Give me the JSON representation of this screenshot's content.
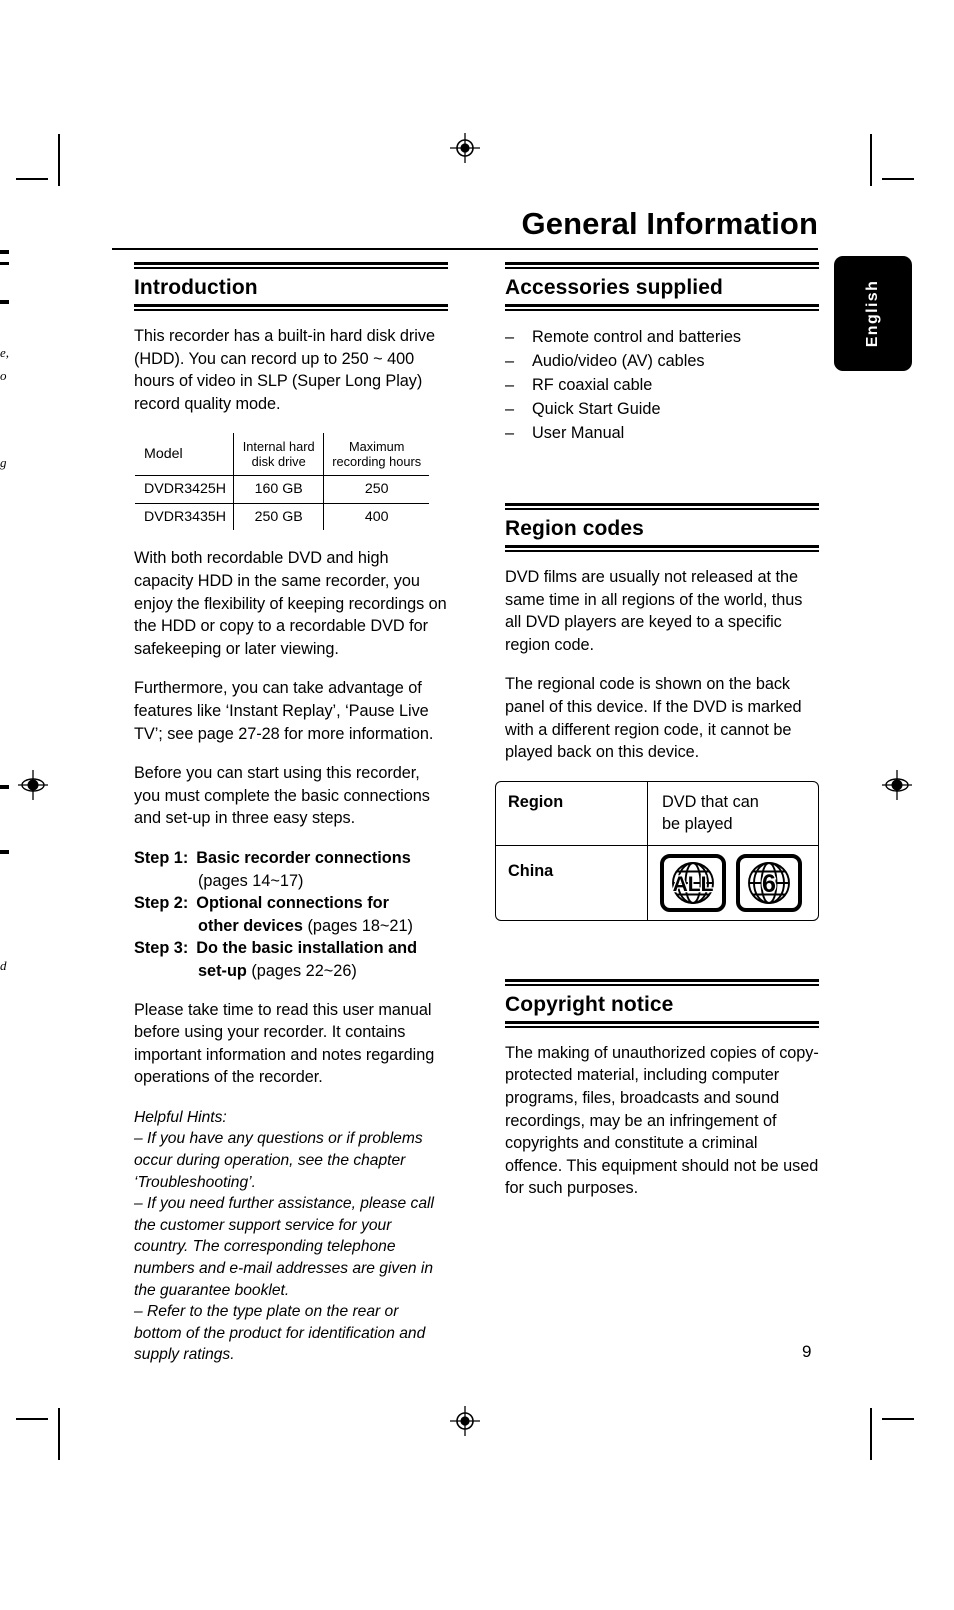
{
  "page": {
    "running_head": "General Information",
    "language_tab": "English",
    "page_number": "9"
  },
  "left_column": {
    "introduction": {
      "heading": "Introduction",
      "paragraph_1": "This recorder has a built-in hard disk drive (HDD). You can record up to 250 ~ 400 hours of video in SLP (Super Long Play) record quality mode.",
      "model_table": {
        "headers": [
          "Model",
          "Internal hard disk drive",
          "Maximum recording hours"
        ],
        "header_line2": [
          "",
          "disk drive",
          "recording hours"
        ],
        "rows": [
          {
            "model": "DVDR3425H",
            "hdd": "160 GB",
            "hours": "250"
          },
          {
            "model": "DVDR3435H",
            "hdd": "250 GB",
            "hours": "400"
          }
        ]
      },
      "paragraph_2": "With both recordable DVD and high capacity HDD in the same recorder, you enjoy the flexibility of keeping recordings on the HDD or copy to a recordable DVD for safekeeping or later viewing.",
      "paragraph_3": "Furthermore, you can take advantage of features like ‘Instant Replay’,  ‘Pause Live TV’; see page 27-28 for more information.",
      "paragraph_4": "Before you can start using this recorder, you must complete the basic connections and set-up in three easy steps.",
      "steps": [
        {
          "label": "Step 1:",
          "bold_text": "Basic recorder connections",
          "plain_text": "",
          "continuation_bold": "",
          "continuation_plain": "(pages 14~17)"
        },
        {
          "label": "Step 2:",
          "bold_text": "Optional connections for",
          "plain_text": "",
          "continuation_bold": "other devices",
          "continuation_plain": " (pages 18~21)"
        },
        {
          "label": "Step 3:",
          "bold_text": "Do the basic installation and",
          "plain_text": "",
          "continuation_bold": "set-up",
          "continuation_plain": " (pages 22~26)"
        }
      ],
      "paragraph_5": "Please take time to read this user manual before using your recorder. It contains important information and notes regarding operations of the recorder.",
      "hints_title": "Helpful Hints:",
      "hints": [
        "– If you have any questions or if problems occur during operation, see the chapter ‘Troubleshooting’.",
        "– If you need further assistance, please call the customer support service for your country. The corresponding telephone numbers and e-mail addresses are given in the guarantee booklet.",
        "– Refer to the type plate on the rear or bottom of the product for identification and supply ratings."
      ]
    }
  },
  "right_column": {
    "accessories": {
      "heading": "Accessories supplied",
      "items": [
        "Remote control and batteries",
        "Audio/video (AV) cables",
        "RF coaxial cable",
        "Quick Start Guide",
        "User Manual"
      ],
      "bullet_glyph": "–"
    },
    "region_codes": {
      "heading": "Region codes",
      "paragraph_1": "DVD films are usually not released at the same time in all regions of the world, thus all DVD players are keyed to a specific region code.",
      "paragraph_2": "The regional code is shown on the back panel of this device. If the DVD is marked with a different region code, it cannot be played back on this device.",
      "table": {
        "header_region": "Region",
        "header_dvd_line1": "DVD that can",
        "header_dvd_line2": "be played",
        "row_region": "China",
        "discs": [
          "ALL",
          "6"
        ]
      }
    },
    "copyright": {
      "heading": "Copyright notice",
      "paragraph": "The making of unauthorized copies of copy-protected material, including computer programs, files, broadcasts and sound recordings, may be an infringement of copyrights and constitute a criminal offence. This equipment should not be used for such purposes."
    }
  },
  "print_marks": {
    "registration_icon": "registration-target-icon",
    "crop_mark": "crop-mark"
  },
  "bleed_fragments": {
    "f1": "e,",
    "f2": "o",
    "f3": "g",
    "f4": "d"
  }
}
